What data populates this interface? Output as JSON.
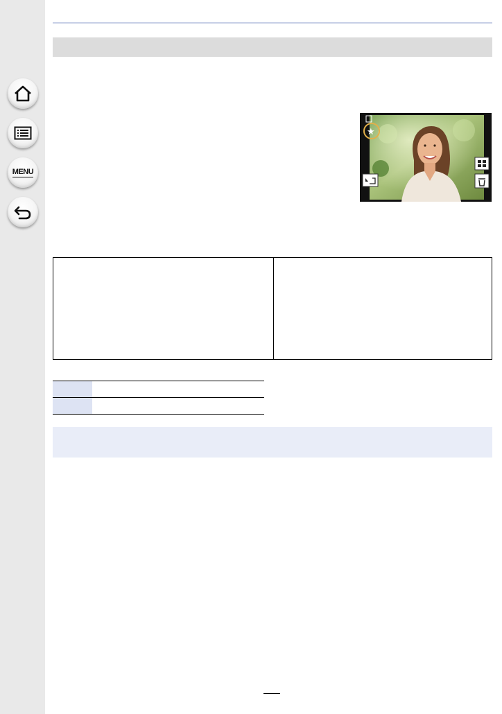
{
  "sidebar": {
    "items": [
      {
        "name": "home",
        "label": ""
      },
      {
        "name": "contents",
        "label": ""
      },
      {
        "name": "menu",
        "label": "MENU"
      },
      {
        "name": "back",
        "label": ""
      }
    ]
  },
  "header": {
    "title": ""
  },
  "photo": {
    "icons": [
      "favorite-star-icon",
      "playback-icon",
      "grid-view-icon",
      "delete-icon",
      "upload-icon"
    ],
    "colors": {
      "highlight_ring": "#e2b04a",
      "frame": "#111111"
    }
  },
  "table": {
    "left_cell": "",
    "right_cell": ""
  },
  "small_table": {
    "rows": [
      {
        "key": "",
        "value": ""
      },
      {
        "key": "",
        "value": ""
      }
    ]
  },
  "note": {
    "text": ""
  },
  "footer": {
    "page_number": ""
  }
}
